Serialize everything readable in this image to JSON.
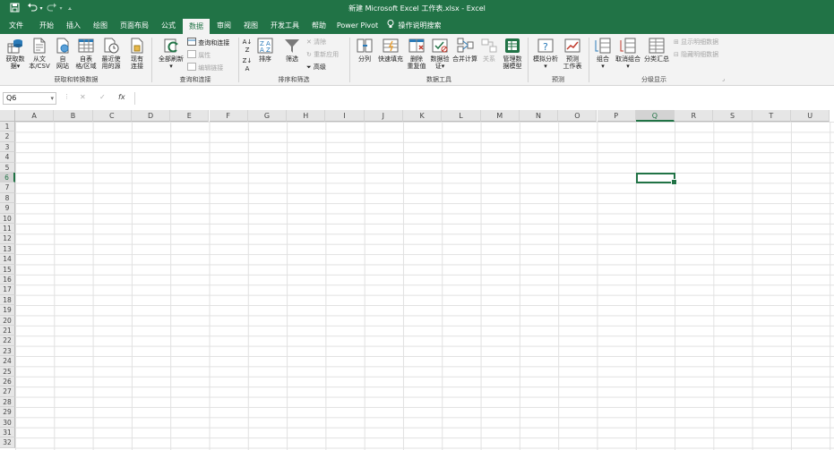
{
  "window": {
    "title": "新建 Microsoft Excel 工作表.xlsx  -  Excel"
  },
  "quick_access": {
    "save_icon": "save-icon",
    "undo_icon": "undo-icon",
    "redo_icon": "redo-icon",
    "customize_icon": "customize-icon"
  },
  "tabs": [
    {
      "label": "文件"
    },
    {
      "label": "开始"
    },
    {
      "label": "插入"
    },
    {
      "label": "绘图"
    },
    {
      "label": "页面布局"
    },
    {
      "label": "公式"
    },
    {
      "label": "数据"
    },
    {
      "label": "审阅"
    },
    {
      "label": "视图"
    },
    {
      "label": "开发工具"
    },
    {
      "label": "帮助"
    },
    {
      "label": "Power Pivot"
    }
  ],
  "tell_me": {
    "label": "操作说明搜索"
  },
  "ribbon": {
    "get_transform": {
      "group_label": "获取和转换数据",
      "get_data": [
        "获取数",
        "据"
      ],
      "from_csv": [
        "从文",
        "本/CSV"
      ],
      "from_web": [
        "自",
        "网站"
      ],
      "from_table": [
        "自表",
        "格/区域"
      ],
      "recent_sources": [
        "最近使",
        "用的源"
      ],
      "existing_conn": [
        "现有",
        "连接"
      ]
    },
    "queries": {
      "group_label": "查询和连接",
      "refresh_all": [
        "全部刷新"
      ],
      "queries_conn": "查询和连接",
      "properties": "属性",
      "edit_links": "编辑链接"
    },
    "sort_filter": {
      "group_label": "排序和筛选",
      "sort": "排序",
      "filter": "筛选",
      "clear": "清除",
      "reapply": "重新应用",
      "advanced": "高级"
    },
    "data_tools": {
      "group_label": "数据工具",
      "text_to_cols": "分列",
      "flash_fill": "快速填充",
      "remove_dup": [
        "删除",
        "重复值"
      ],
      "validation": [
        "数据验",
        "证"
      ],
      "consolidate": "合并计算",
      "relationships": "关系",
      "manage_model": [
        "管理数",
        "据模型"
      ]
    },
    "forecast": {
      "group_label": "预测",
      "what_if": "模拟分析",
      "forecast_sheet": [
        "预测",
        "工作表"
      ]
    },
    "outline": {
      "group_label": "分级显示",
      "group": "组合",
      "ungroup": "取消组合",
      "subtotal": "分类汇总",
      "show_detail": "显示明细数据",
      "hide_detail": "隐藏明细数据"
    }
  },
  "formula_bar": {
    "name_box": "Q6",
    "cancel": "✕",
    "enter": "✓",
    "fx": "fx",
    "value": ""
  },
  "sheet": {
    "columns": [
      "A",
      "B",
      "C",
      "D",
      "E",
      "F",
      "G",
      "H",
      "I",
      "J",
      "K",
      "L",
      "M",
      "N",
      "O",
      "P",
      "Q",
      "R",
      "S",
      "T",
      "U"
    ],
    "rows": [
      "1",
      "2",
      "3",
      "4",
      "5",
      "6",
      "7",
      "8",
      "9",
      "10",
      "11",
      "12",
      "13",
      "14",
      "15",
      "16",
      "17",
      "18",
      "19",
      "20",
      "21",
      "22",
      "23",
      "24",
      "25",
      "26",
      "27",
      "28",
      "29",
      "30",
      "31",
      "32"
    ],
    "selected_column": "Q",
    "selected_row": "6"
  }
}
